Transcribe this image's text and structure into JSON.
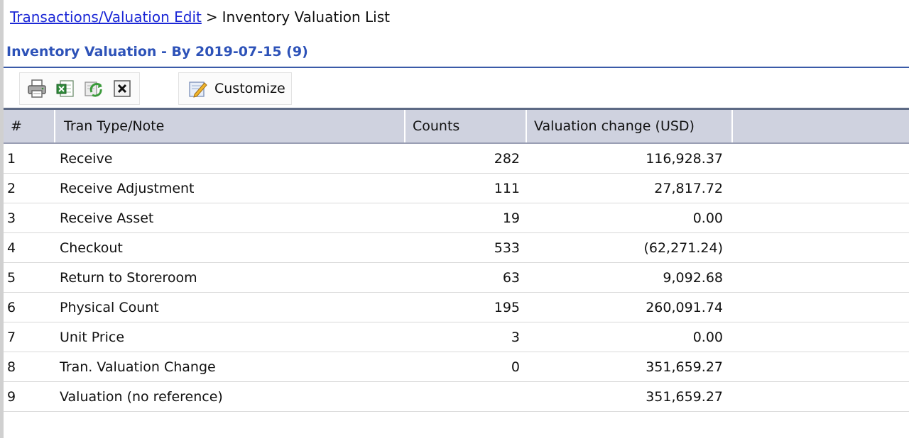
{
  "breadcrumb": {
    "link": "Transactions/Valuation Edit",
    "separator": ">",
    "current": "Inventory Valuation List"
  },
  "title": "Inventory Valuation - By 2019-07-15 (9)",
  "toolbar": {
    "customize_label": "Customize",
    "icons": [
      "print-icon",
      "export-excel-icon",
      "refresh-icon",
      "close-icon",
      "customize-icon"
    ]
  },
  "table": {
    "columns": [
      "#",
      "Tran Type/Note",
      "Counts",
      "Valuation change (USD)"
    ],
    "rows": [
      {
        "num": "1",
        "type": "Receive",
        "count": "282",
        "value": "116,928.37"
      },
      {
        "num": "2",
        "type": "Receive Adjustment",
        "count": "111",
        "value": "27,817.72"
      },
      {
        "num": "3",
        "type": "Receive Asset",
        "count": "19",
        "value": "0.00"
      },
      {
        "num": "4",
        "type": "Checkout",
        "count": "533",
        "value": "(62,271.24)"
      },
      {
        "num": "5",
        "type": "Return to Storeroom",
        "count": "63",
        "value": "9,092.68"
      },
      {
        "num": "6",
        "type": "Physical Count",
        "count": "195",
        "value": "260,091.74"
      },
      {
        "num": "7",
        "type": "Unit Price",
        "count": "3",
        "value": "0.00"
      },
      {
        "num": "8",
        "type": "Tran. Valuation Change",
        "count": "0",
        "value": "351,659.27"
      },
      {
        "num": "9",
        "type": "Valuation (no reference)",
        "count": "",
        "value": "351,659.27"
      }
    ]
  }
}
